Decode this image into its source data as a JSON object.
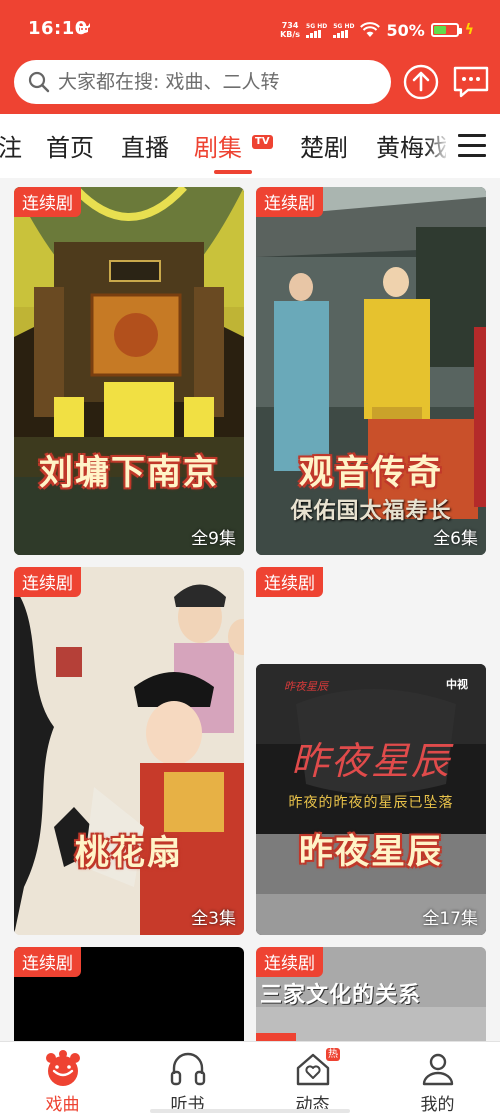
{
  "status_bar": {
    "time": "16:10",
    "net_speed_value": "734",
    "net_speed_unit": "KB/s",
    "signal_1": "5G HD",
    "signal_2": "5G HD",
    "battery_percent": "50%",
    "battery_level": 0.5
  },
  "search": {
    "placeholder": "大家都在搜: 戏曲、二人转"
  },
  "tabs": [
    {
      "label": "注"
    },
    {
      "label": "首页"
    },
    {
      "label": "直播"
    },
    {
      "label": "剧集",
      "active": true,
      "badge": "TV"
    },
    {
      "label": "楚剧"
    },
    {
      "label": "黄梅戏"
    }
  ],
  "cards": [
    {
      "badge": "连续剧",
      "title": "刘墉下南京",
      "episodes": "全9集"
    },
    {
      "badge": "连续剧",
      "title": "观音传奇",
      "subtitle": "保佑国太福寿长",
      "episodes": "全6集"
    },
    {
      "badge": "连续剧",
      "title": "桃花扇",
      "episodes": "全3集"
    },
    {
      "badge": "连续剧",
      "title": "昨夜星辰",
      "subtitle": "昨夜的昨夜的星辰已坠落",
      "episodes": "全17集",
      "logo_title": "昨夜星辰",
      "channel": "中视"
    },
    {
      "badge": "连续剧"
    },
    {
      "badge": "连续剧",
      "caption": "三家文化的关系"
    }
  ],
  "bottom_nav": [
    {
      "label": "戏曲",
      "icon": "opera-mascot-icon",
      "active": true
    },
    {
      "label": "听书",
      "icon": "headphones-icon"
    },
    {
      "label": "动态",
      "icon": "house-heart-icon",
      "badge": "热"
    },
    {
      "label": "我的",
      "icon": "person-icon"
    }
  ],
  "colors": {
    "brand": "#ee4332",
    "title_fill": "#fff4c8"
  }
}
